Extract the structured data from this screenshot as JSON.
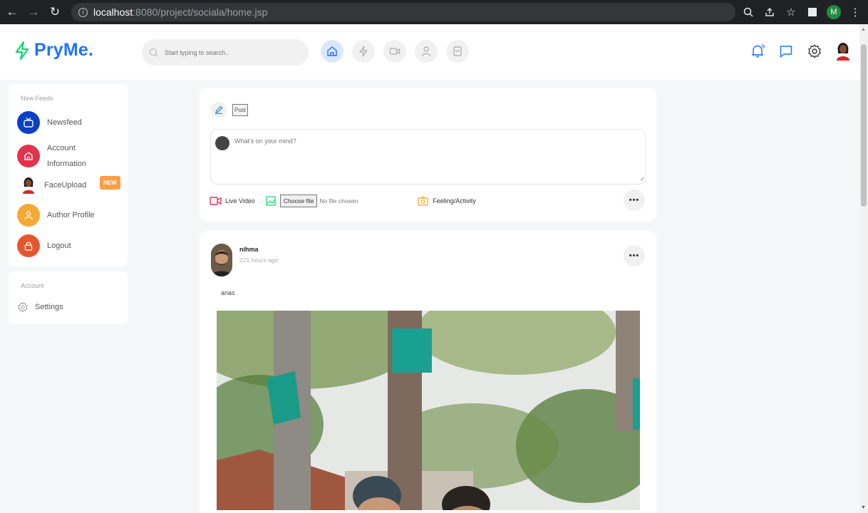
{
  "browser": {
    "url_host": "localhost",
    "url_path": ":8080/project/sociala/home.jsp",
    "profile_initial": "M"
  },
  "header": {
    "logo_text": "PryMe.",
    "search_placeholder": "Start typing to search..",
    "accent_color": "#1e74fd",
    "nav_icons": [
      "home-icon",
      "bolt-icon",
      "video-icon",
      "user-icon",
      "shop-icon"
    ]
  },
  "sidebar": {
    "section_title": "New Feeds",
    "items": [
      {
        "label": "Newsfeed",
        "icon": "tv-icon",
        "color": "#1e74fd"
      },
      {
        "label": "Account",
        "label2": "Information",
        "icon": "home-icon",
        "color": "#e2334c"
      },
      {
        "label": "FaceUpload",
        "icon": "avatar-icon",
        "badge": "NEW"
      },
      {
        "label": "Author Profile",
        "icon": "user-icon",
        "color": "#f4a935"
      },
      {
        "label": "Logout",
        "icon": "lock-icon",
        "color": "#e4572e"
      }
    ],
    "account_title": "Account",
    "settings_label": "Settings"
  },
  "composer": {
    "post_label": "Post",
    "placeholder": "What's on your mind?",
    "live_video_label": "Live Video",
    "choose_file_label": "Choose file",
    "no_file_label": "No file chosen",
    "feeling_label": "Feeling/Activity"
  },
  "post": {
    "username": "nihma",
    "time": "221 hours ago",
    "text": "anas"
  }
}
